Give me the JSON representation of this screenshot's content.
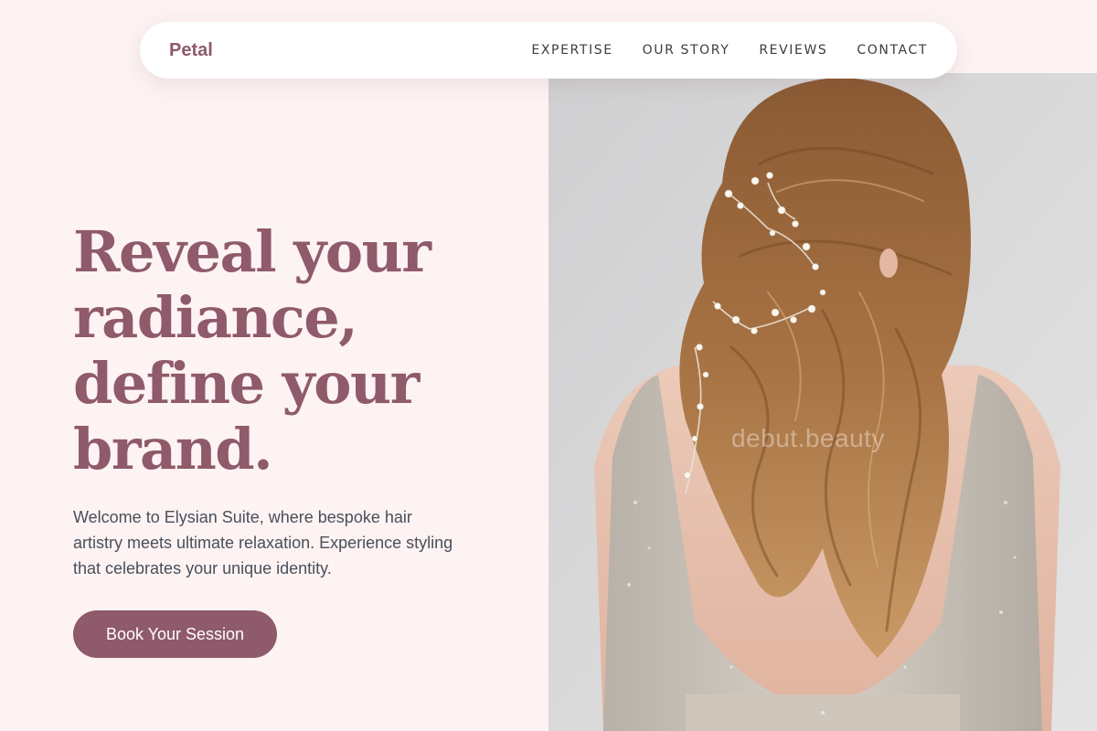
{
  "brand": {
    "name": "Petal"
  },
  "nav": {
    "items": [
      {
        "label": "EXPERTISE"
      },
      {
        "label": "OUR STORY"
      },
      {
        "label": "REVIEWS"
      },
      {
        "label": "CONTACT"
      }
    ]
  },
  "hero": {
    "headline": "Reveal your radiance, define your brand.",
    "intro": "Welcome to Elysian Suite, where bespoke hair artistry meets ultimate relaxation. Experience styling that celebrates your unique identity.",
    "cta_label": "Book Your Session",
    "photo_watermark": "debut.beauty"
  },
  "colors": {
    "page_background": "#fdf3f3",
    "accent": "#8f5a6b",
    "nav_background": "#ffffff",
    "body_text": "#4a4f5a"
  }
}
